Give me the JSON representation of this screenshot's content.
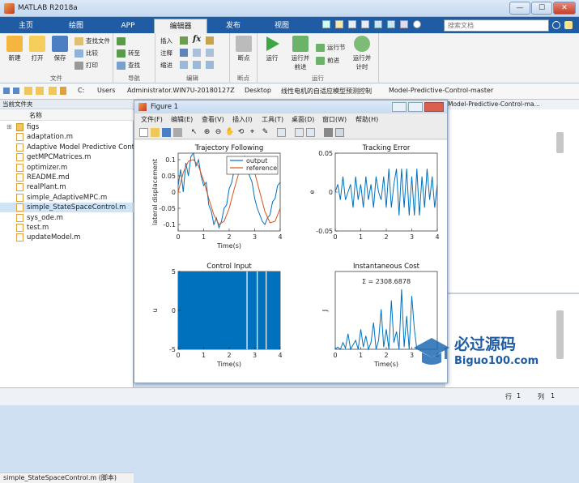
{
  "app": {
    "title": "MATLAB R2018a",
    "win_buttons": [
      "—",
      "☐",
      "✕"
    ]
  },
  "tabs": [
    {
      "label": "主页",
      "active": false
    },
    {
      "label": "绘图",
      "active": false
    },
    {
      "label": "APP",
      "active": false
    },
    {
      "label": "编辑器",
      "active": true
    },
    {
      "label": "发布",
      "active": false
    },
    {
      "label": "视图",
      "active": false
    }
  ],
  "search": {
    "placeholder": "搜索文档"
  },
  "ribbon": {
    "file": {
      "label": "文件",
      "new": "新建",
      "open": "打开",
      "save": "保存",
      "find_files": "查找文件",
      "compare": "比较",
      "print": "打印"
    },
    "nav": {
      "label": "导航",
      "goto": "转至",
      "find": "查找"
    },
    "edit": {
      "label": "编辑",
      "insert": "插入",
      "comment": "注释",
      "indent": "缩进",
      "fx": "fx"
    },
    "breakpoints": {
      "label": "断点",
      "bp": "断点"
    },
    "run": {
      "label": "运行",
      "run": "运行",
      "run_advance_1": "运行并",
      "run_advance_2": "前进",
      "run_section": "运行节",
      "advance": "前进",
      "run_time_1": "运行并",
      "run_time_2": "计时"
    }
  },
  "path": {
    "segments": [
      "C:",
      "Users",
      "Administrator.WIN7U-20180127Z",
      "Desktop",
      "线性电机的自适应模型预测控制",
      "Model-Predictive-Control-master"
    ]
  },
  "left_panel": {
    "header": "当前文件夹",
    "col_name": "名称",
    "items": [
      {
        "name": "figs",
        "type": "folder"
      },
      {
        "name": "adaptation.m",
        "type": "m"
      },
      {
        "name": "Adaptive Model Predictive Control",
        "type": "m"
      },
      {
        "name": "getMPCMatrices.m",
        "type": "m"
      },
      {
        "name": "optimizer.m",
        "type": "m"
      },
      {
        "name": "README.md",
        "type": "md"
      },
      {
        "name": "realPlant.m",
        "type": "m"
      },
      {
        "name": "simple_AdaptiveMPC.m",
        "type": "m"
      },
      {
        "name": "simple_StateSpaceControl.m",
        "type": "m",
        "selected": true
      },
      {
        "name": "sys_ode.m",
        "type": "m"
      },
      {
        "name": "test.m",
        "type": "m"
      },
      {
        "name": "updateModel.m",
        "type": "m"
      }
    ],
    "status": "simple_StateSpaceControl.m (脚本)"
  },
  "right_path": "Model-Predictive-Control-ma...",
  "bottom": {
    "row": "行",
    "row_val": "1",
    "col": "列",
    "col_val": "1"
  },
  "figure": {
    "title": "Figure 1",
    "menu": [
      "文件(F)",
      "编辑(E)",
      "查看(V)",
      "插入(I)",
      "工具(T)",
      "桌面(D)",
      "窗口(W)",
      "帮助(H)"
    ]
  },
  "chart_data": [
    {
      "type": "line",
      "title": "Trajectory Following",
      "xlabel": "Time(s)",
      "ylabel": "lateral displacement",
      "xlim": [
        0,
        4
      ],
      "ylim": [
        -0.12,
        0.12
      ],
      "xticks": [
        "0",
        "1",
        "2",
        "3",
        "4"
      ],
      "yticks": [
        "-0.1",
        "-0.05",
        "0",
        "0.05",
        "0.1"
      ],
      "yticks_vals": [
        -0.1,
        -0.05,
        0,
        0.05,
        0.1
      ],
      "legend": [
        "output",
        "reference"
      ],
      "legend_position": "top-right",
      "series": [
        {
          "name": "output",
          "color": "#0072bd",
          "x": [
            0,
            0.1,
            0.2,
            0.3,
            0.4,
            0.5,
            0.6,
            0.7,
            0.8,
            0.9,
            1.0,
            1.1,
            1.2,
            1.3,
            1.4,
            1.5,
            1.6,
            1.7,
            1.8,
            1.9,
            2.0,
            2.1,
            2.2,
            2.3,
            2.4,
            2.5,
            2.6,
            2.7,
            2.8,
            2.9,
            3.0,
            3.1,
            3.2,
            3.3,
            3.4,
            3.5,
            3.6,
            3.7,
            3.8,
            3.9,
            4.0
          ],
          "y": [
            0.02,
            0.07,
            0.0,
            0.09,
            0.05,
            0.11,
            0.12,
            0.08,
            0.1,
            0.05,
            0.02,
            0.03,
            -0.04,
            -0.06,
            -0.1,
            -0.08,
            -0.11,
            -0.09,
            -0.05,
            -0.04,
            0.01,
            0.03,
            0.07,
            0.06,
            0.1,
            0.09,
            0.11,
            0.07,
            0.05,
            0.03,
            -0.02,
            -0.05,
            -0.07,
            -0.09,
            -0.1,
            -0.08,
            -0.07,
            -0.03,
            -0.02,
            0.02,
            0.03
          ]
        },
        {
          "name": "reference",
          "color": "#d95319",
          "x": [
            0,
            0.2,
            0.4,
            0.6,
            0.8,
            1.0,
            1.2,
            1.4,
            1.6,
            1.8,
            2.0,
            2.2,
            2.4,
            2.6,
            2.8,
            3.0,
            3.2,
            3.4,
            3.6,
            3.8,
            4.0
          ],
          "y": [
            0.0,
            0.06,
            0.095,
            0.1,
            0.08,
            0.035,
            -0.02,
            -0.07,
            -0.1,
            -0.09,
            -0.05,
            0.01,
            0.065,
            0.095,
            0.095,
            0.06,
            0.0,
            -0.06,
            -0.095,
            -0.09,
            -0.05
          ]
        }
      ]
    },
    {
      "type": "line",
      "title": "Tracking Error",
      "xlabel": "",
      "ylabel": "e",
      "xlim": [
        0,
        4
      ],
      "ylim": [
        -0.05,
        0.05
      ],
      "xticks": [
        "0",
        "1",
        "2",
        "3",
        "4"
      ],
      "yticks": [
        "-0.05",
        "0",
        "0.05"
      ],
      "yticks_vals": [
        -0.05,
        0,
        0.05
      ],
      "series": [
        {
          "name": "",
          "color": "#0072bd",
          "x": [
            0,
            0.1,
            0.2,
            0.3,
            0.4,
            0.5,
            0.6,
            0.7,
            0.8,
            0.9,
            1.0,
            1.1,
            1.2,
            1.3,
            1.4,
            1.5,
            1.6,
            1.7,
            1.8,
            1.9,
            2.0,
            2.1,
            2.2,
            2.3,
            2.4,
            2.5,
            2.6,
            2.7,
            2.8,
            2.9,
            3.0,
            3.1,
            3.2,
            3.3,
            3.4,
            3.5,
            3.6,
            3.7,
            3.8,
            3.9,
            4.0
          ],
          "y": [
            0.0,
            0.01,
            -0.01,
            0.02,
            -0.01,
            0.0,
            0.01,
            -0.02,
            0.02,
            -0.01,
            0.01,
            -0.02,
            0.02,
            -0.01,
            0.01,
            -0.02,
            0.02,
            0.0,
            -0.01,
            0.02,
            -0.02,
            0.03,
            -0.02,
            0.01,
            0.03,
            -0.03,
            0.03,
            -0.02,
            0.03,
            -0.03,
            0.02,
            -0.03,
            0.03,
            -0.03,
            0.02,
            -0.02,
            0.03,
            -0.01,
            0.02,
            -0.02,
            0.01
          ]
        }
      ]
    },
    {
      "type": "bar",
      "title": "Control Input",
      "xlabel": "Time(s)",
      "ylabel": "u",
      "xlim": [
        0,
        4
      ],
      "ylim": [
        -5,
        5
      ],
      "xticks": [
        "0",
        "1",
        "2",
        "3",
        "4"
      ],
      "yticks": [
        "-5",
        "0",
        "5"
      ],
      "yticks_vals": [
        -5,
        0,
        5
      ],
      "fill_color": "#0072bd",
      "gaps_x": [
        2.7,
        3.1,
        3.45
      ]
    },
    {
      "type": "line",
      "title": "Instantaneous Cost",
      "xlabel": "Time(s)",
      "ylabel": "J",
      "xlim": [
        0,
        4
      ],
      "ylim": [
        0,
        3500
      ],
      "xticks": [
        "0",
        "1",
        "2",
        "3",
        "4"
      ],
      "yticks": [],
      "yticks_vals": [],
      "annotation": "Σ = 2308.6878",
      "series": [
        {
          "name": "",
          "color": "#0072bd",
          "x": [
            0,
            0.1,
            0.2,
            0.3,
            0.4,
            0.5,
            0.6,
            0.7,
            0.8,
            0.9,
            1.0,
            1.1,
            1.2,
            1.3,
            1.4,
            1.5,
            1.6,
            1.7,
            1.8,
            1.9,
            2.0,
            2.1,
            2.2,
            2.3,
            2.4,
            2.5,
            2.6,
            2.7,
            2.8,
            2.9,
            3.0,
            3.1,
            3.2
          ],
          "y": [
            0,
            100,
            0,
            300,
            50,
            700,
            0,
            200,
            400,
            0,
            900,
            100,
            600,
            0,
            300,
            1200,
            0,
            400,
            1800,
            100,
            900,
            0,
            2200,
            300,
            800,
            0,
            2700,
            100,
            1500,
            0,
            2400,
            900,
            0
          ]
        }
      ]
    }
  ]
}
